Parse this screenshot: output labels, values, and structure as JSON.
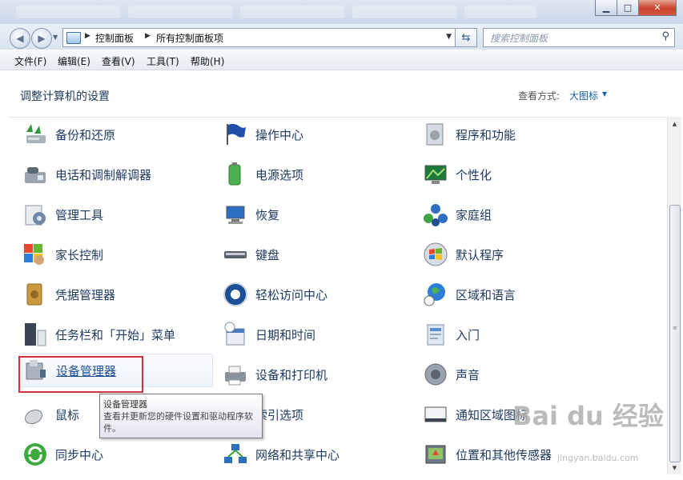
{
  "window": {
    "controls": {
      "minimize": "▁",
      "maximize": "□",
      "close": "✕"
    }
  },
  "address": {
    "crumbs": [
      "控制面板",
      "所有控制面板项"
    ],
    "search_placeholder": "搜索控制面板"
  },
  "menu": [
    "文件(F)",
    "编辑(E)",
    "查看(V)",
    "工具(T)",
    "帮助(H)"
  ],
  "header": {
    "title": "调整计算机的设置",
    "view_label": "查看方式:",
    "view_value": "大图标"
  },
  "items": {
    "col1": [
      "备份和还原",
      "电话和调制解调器",
      "管理工具",
      "家长控制",
      "凭据管理器",
      "任务栏和「开始」菜单",
      "设备管理器",
      "鼠标",
      "同步中心"
    ],
    "col2": [
      "操作中心",
      "电源选项",
      "恢复",
      "键盘",
      "轻松访问中心",
      "日期和时间",
      "设备和打印机",
      "索引选项",
      "网络和共享中心"
    ],
    "col3": [
      "程序和功能",
      "个性化",
      "家庭组",
      "默认程序",
      "区域和语言",
      "入门",
      "声音",
      "通知区域图标",
      "位置和其他传感器"
    ]
  },
  "tooltip": {
    "title": "设备管理器",
    "body": "查看并更新您的硬件设置和驱动程序软件。"
  },
  "watermark": {
    "text": "Bai du 经验",
    "sub": "jingyan.baidu.com"
  }
}
